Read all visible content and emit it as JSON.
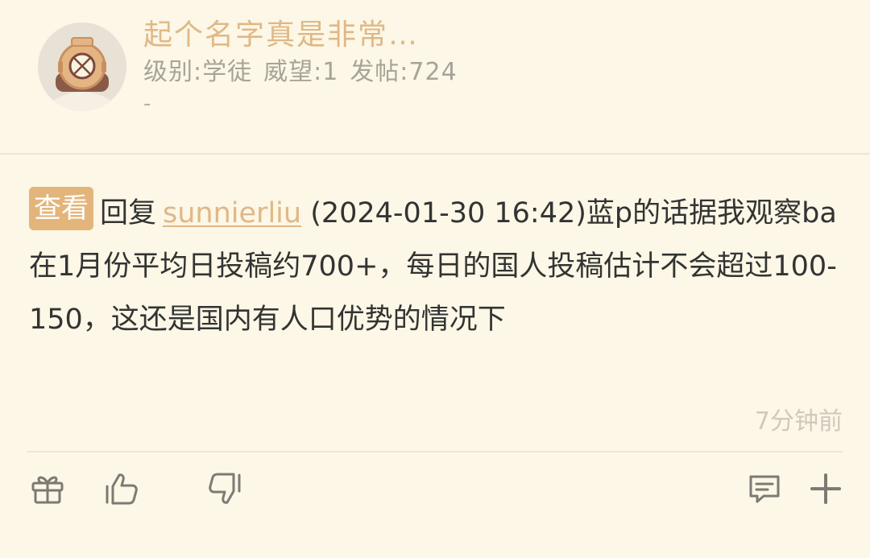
{
  "post": {
    "username": "起个名字真是非常…",
    "meta": {
      "level": "级别:学徒",
      "prestige": "威望:1",
      "posts": "发帖:724"
    },
    "signature": "-",
    "view_badge": "查看",
    "reply_word": "回复",
    "reply_user": "sunnierliu",
    "reply_text": " (2024-01-30 16:42)蓝p的话据我观察ba在1月份平均日投稿约700+，每日的国人投稿估计不会超过100-150，这还是国内有人口优势的情况下",
    "time": "7分钟前"
  },
  "icons": {
    "gift": "gift-icon",
    "like": "thumbs-up-icon",
    "dislike": "thumbs-down-icon",
    "comment": "comment-icon",
    "more": "plus-icon"
  },
  "colors": {
    "background": "#fcf7e6",
    "accent": "#e0b886",
    "badge": "#e3b57b",
    "icon": "#7d7a75"
  }
}
